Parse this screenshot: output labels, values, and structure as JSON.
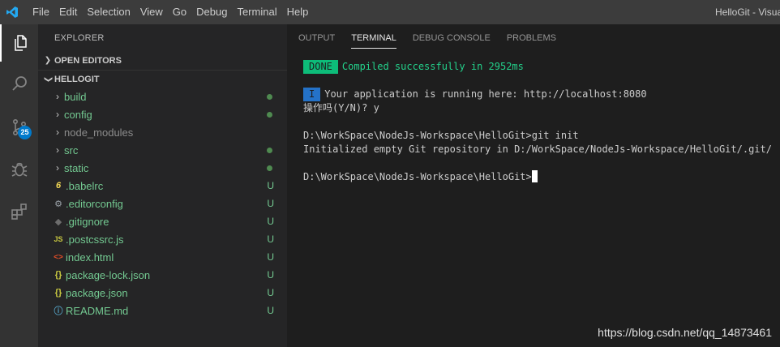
{
  "menu": [
    "File",
    "Edit",
    "Selection",
    "View",
    "Go",
    "Debug",
    "Terminal",
    "Help"
  ],
  "window_title": "HelloGit - Visual Studio Code",
  "activity": {
    "scm_badge": "25"
  },
  "explorer": {
    "title": "EXPLORER",
    "open_editors": "OPEN EDITORS",
    "folder": "HELLOGIT",
    "items": [
      {
        "name": "build",
        "type": "folder",
        "status": "dot"
      },
      {
        "name": "config",
        "type": "folder",
        "status": "dot"
      },
      {
        "name": "node_modules",
        "type": "folder",
        "status": ""
      },
      {
        "name": "src",
        "type": "folder",
        "status": "dot"
      },
      {
        "name": "static",
        "type": "folder",
        "status": "dot"
      },
      {
        "name": ".babelrc",
        "type": "babel",
        "status": "U"
      },
      {
        "name": ".editorconfig",
        "type": "gear",
        "status": "U"
      },
      {
        "name": ".gitignore",
        "type": "git",
        "status": "U"
      },
      {
        "name": ".postcssrc.js",
        "type": "js",
        "status": "U"
      },
      {
        "name": "index.html",
        "type": "html",
        "status": "U"
      },
      {
        "name": "package-lock.json",
        "type": "json",
        "status": "U"
      },
      {
        "name": "package.json",
        "type": "json",
        "status": "U"
      },
      {
        "name": "README.md",
        "type": "info",
        "status": "U"
      }
    ]
  },
  "panel": {
    "tabs": [
      "OUTPUT",
      "TERMINAL",
      "DEBUG CONSOLE",
      "PROBLEMS"
    ],
    "active_tab": "TERMINAL"
  },
  "terminal": {
    "done_tag": "DONE",
    "compiled": "Compiled successfully in 2952ms",
    "info_tag": "I",
    "running": "Your application is running here: http://localhost:8080",
    "prompt_yn": "操作吗(Y/N)? y",
    "cmd1": "D:\\WorkSpace\\NodeJs-Workspace\\HelloGit>git init",
    "cmd1_out": "Initialized empty Git repository in D:/WorkSpace/NodeJs-Workspace/HelloGit/.git/",
    "prompt2": "D:\\WorkSpace\\NodeJs-Workspace\\HelloGit>"
  },
  "watermark": "https://blog.csdn.net/qq_14873461",
  "colors": {
    "accent": "#007acc",
    "untracked": "#73c991",
    "done_bg": "#0dbc79",
    "info_bg": "#2472c8"
  }
}
